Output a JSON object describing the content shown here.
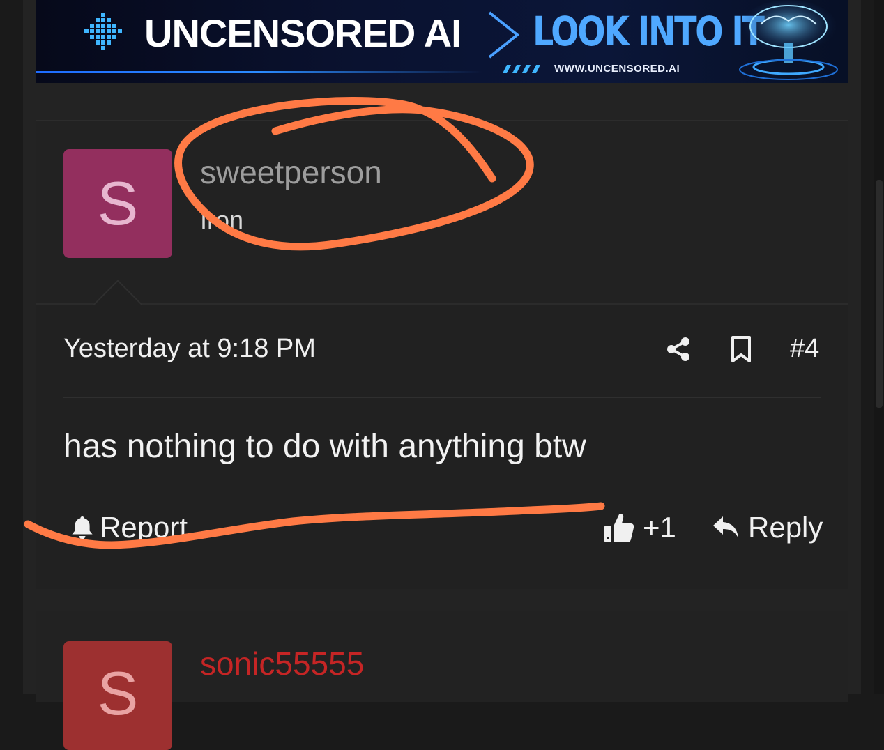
{
  "banner": {
    "brand": "UNCENSORED AI",
    "tagline": "LOOK INTO IT",
    "url": "WWW.UNCENSORED.AI"
  },
  "post": {
    "avatar_letter": "S",
    "avatar_color": "#932f5e",
    "username": "sweetperson",
    "user_title": "Iron",
    "timestamp": "Yesterday at 9:18 PM",
    "post_number": "#4",
    "body": "has nothing to do with anything btw",
    "actions": {
      "report_label": "Report",
      "like_label": "+1",
      "reply_label": "Reply"
    }
  },
  "next_post": {
    "avatar_letter": "S",
    "avatar_color": "#9d3030",
    "username": "sonic55555",
    "username_color": "#c52525"
  },
  "annotation": {
    "color": "#ff7a45"
  }
}
